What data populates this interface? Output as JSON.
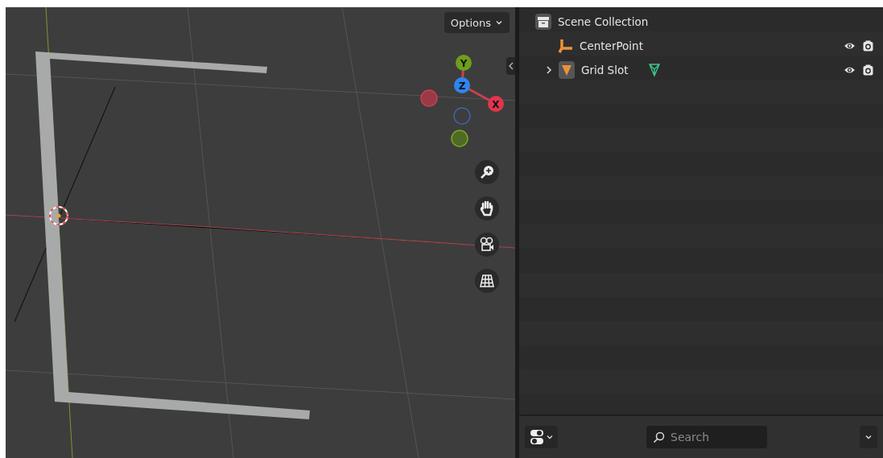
{
  "viewport": {
    "options_button": {
      "label": "Options"
    },
    "gizmo_axes": [
      {
        "label": "Y",
        "color": "#6d9f1c"
      },
      {
        "label": "Z",
        "color": "#2f86f0"
      },
      {
        "label": "X",
        "color": "#e0354f"
      }
    ]
  },
  "outliner": {
    "items": [
      {
        "kind": "collection",
        "label": "Scene Collection",
        "children": [
          {
            "kind": "empty",
            "label": "CenterPoint"
          },
          {
            "kind": "mesh",
            "label": "Grid Slot",
            "expanded": false
          }
        ]
      }
    ]
  },
  "footer": {
    "search": {
      "placeholder": "Search"
    }
  }
}
